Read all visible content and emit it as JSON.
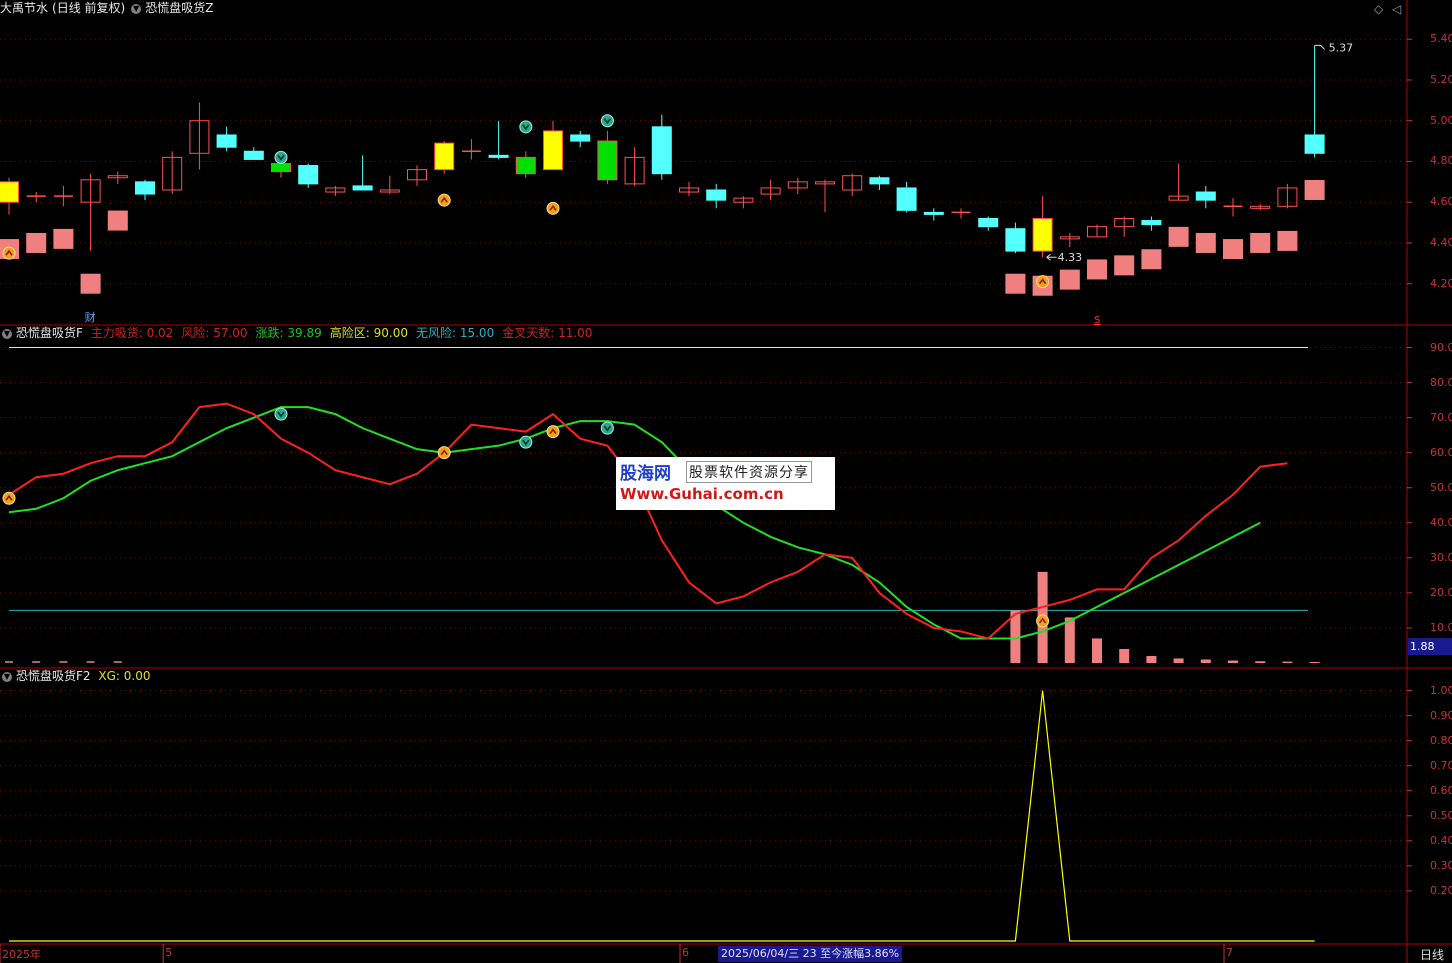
{
  "header": {
    "stock": "大禹节水",
    "period_mode": "(日线 前复权)",
    "indicator_main": "恐慌盘吸货Z"
  },
  "panel2": {
    "name": "恐慌盘吸货F",
    "items": [
      {
        "label": "主力吸货:",
        "value": "0.02",
        "color": "#d02020"
      },
      {
        "label": "风险:",
        "value": "57.00",
        "color": "#d02020"
      },
      {
        "label": "涨跌:",
        "value": "39.89",
        "color": "#20c020"
      },
      {
        "label": "高险区:",
        "value": "90.00",
        "color": "#e0e020"
      },
      {
        "label": "无风险:",
        "value": "15.00",
        "color": "#30b0c0"
      },
      {
        "label": "金叉天数:",
        "value": "11.00",
        "color": "#d02020"
      }
    ]
  },
  "panel3": {
    "name": "恐慌盘吸货F2",
    "items": [
      {
        "label": "XG:",
        "value": "0.00",
        "color": "#e0e020"
      }
    ]
  },
  "price_axis": [
    "5.40",
    "5.20",
    "5.00",
    "4.80",
    "4.60",
    "4.40",
    "4.20"
  ],
  "osc_axis": [
    "90.00",
    "80.00",
    "70.00",
    "60.00",
    "50.00",
    "40.00",
    "30.00",
    "20.00",
    "10.00"
  ],
  "xg_axis": [
    "1.00",
    "0.90",
    "0.80",
    "0.70",
    "0.60",
    "0.50",
    "0.40",
    "0.30",
    "0.20"
  ],
  "x_labels": [
    {
      "text": "2025年",
      "bar": 0
    },
    {
      "text": "5",
      "bar": 6
    },
    {
      "text": "6",
      "bar": 25
    },
    {
      "text": "7",
      "bar": 45
    }
  ],
  "cursor_readout": "2025/06/04/三 23 至今涨幅3.86%",
  "value_flag": "1.88",
  "period_label": "日线",
  "annotations": {
    "high": "5.37",
    "low": "4.33",
    "cai": "财",
    "s_mark": "S"
  },
  "watermark": {
    "line1": "股海网",
    "line2": "股票软件资源分享",
    "line3": "Www.Guhai.com.cn"
  },
  "colors": {
    "up": "#ff5050",
    "down": "#54ffff",
    "grid": "#8b0000",
    "red_line": "#ff2020",
    "green_line": "#20e020",
    "yellow": "#ffff00",
    "hl_up": "#ffff00",
    "hl_down": "#00e000"
  },
  "chart_data": {
    "type": "candlestick",
    "price_ylim": [
      4.12,
      5.46
    ],
    "osc_ylim": [
      0,
      95
    ],
    "xg_ylim": [
      0,
      1.05
    ],
    "candles": [
      {
        "o": 4.6,
        "h": 4.72,
        "l": 4.54,
        "c": 4.7,
        "hl": "yes"
      },
      {
        "o": 4.63,
        "h": 4.65,
        "l": 4.6,
        "c": 4.63
      },
      {
        "o": 4.63,
        "h": 4.68,
        "l": 4.58,
        "c": 4.63
      },
      {
        "o": 4.6,
        "h": 4.74,
        "l": 4.36,
        "c": 4.71
      },
      {
        "o": 4.72,
        "h": 4.75,
        "l": 4.69,
        "c": 4.73
      },
      {
        "o": 4.7,
        "h": 4.71,
        "l": 4.61,
        "c": 4.64
      },
      {
        "o": 4.66,
        "h": 4.85,
        "l": 4.64,
        "c": 4.82
      },
      {
        "o": 4.84,
        "h": 5.09,
        "l": 4.76,
        "c": 5.0
      },
      {
        "o": 4.93,
        "h": 4.97,
        "l": 4.85,
        "c": 4.87
      },
      {
        "o": 4.85,
        "h": 4.87,
        "l": 4.81,
        "c": 4.81
      },
      {
        "o": 4.75,
        "h": 4.79,
        "l": 4.72,
        "c": 4.79,
        "hl": "green"
      },
      {
        "o": 4.78,
        "h": 4.79,
        "l": 4.67,
        "c": 4.69
      },
      {
        "o": 4.65,
        "h": 4.68,
        "l": 4.63,
        "c": 4.67
      },
      {
        "o": 4.68,
        "h": 4.83,
        "l": 4.66,
        "c": 4.66
      },
      {
        "o": 4.65,
        "h": 4.73,
        "l": 4.64,
        "c": 4.66
      },
      {
        "o": 4.71,
        "h": 4.78,
        "l": 4.68,
        "c": 4.76
      },
      {
        "o": 4.76,
        "h": 4.9,
        "l": 4.74,
        "c": 4.89,
        "hl": "yes"
      },
      {
        "o": 4.85,
        "h": 4.91,
        "l": 4.81,
        "c": 4.85
      },
      {
        "o": 4.83,
        "h": 5.0,
        "l": 4.81,
        "c": 4.82
      },
      {
        "o": 4.82,
        "h": 4.85,
        "l": 4.72,
        "c": 4.74,
        "hl": "green"
      },
      {
        "o": 4.76,
        "h": 5.0,
        "l": 4.76,
        "c": 4.95,
        "hl": "yes"
      },
      {
        "o": 4.93,
        "h": 4.95,
        "l": 4.87,
        "c": 4.9
      },
      {
        "o": 4.9,
        "h": 4.95,
        "l": 4.69,
        "c": 4.71,
        "hl": "green"
      },
      {
        "o": 4.69,
        "h": 4.87,
        "l": 4.68,
        "c": 4.82
      },
      {
        "o": 4.97,
        "h": 5.03,
        "l": 4.71,
        "c": 4.74
      },
      {
        "o": 4.65,
        "h": 4.7,
        "l": 4.63,
        "c": 4.67
      },
      {
        "o": 4.66,
        "h": 4.69,
        "l": 4.57,
        "c": 4.61
      },
      {
        "o": 4.6,
        "h": 4.63,
        "l": 4.57,
        "c": 4.62
      },
      {
        "o": 4.64,
        "h": 4.71,
        "l": 4.61,
        "c": 4.67
      },
      {
        "o": 4.67,
        "h": 4.72,
        "l": 4.64,
        "c": 4.7
      },
      {
        "o": 4.69,
        "h": 4.71,
        "l": 4.55,
        "c": 4.7
      },
      {
        "o": 4.66,
        "h": 4.74,
        "l": 4.63,
        "c": 4.73
      },
      {
        "o": 4.72,
        "h": 4.73,
        "l": 4.66,
        "c": 4.69
      },
      {
        "o": 4.67,
        "h": 4.7,
        "l": 4.55,
        "c": 4.56
      },
      {
        "o": 4.55,
        "h": 4.57,
        "l": 4.51,
        "c": 4.54
      },
      {
        "o": 4.55,
        "h": 4.57,
        "l": 4.52,
        "c": 4.55
      },
      {
        "o": 4.52,
        "h": 4.53,
        "l": 4.46,
        "c": 4.48
      },
      {
        "o": 4.47,
        "h": 4.5,
        "l": 4.35,
        "c": 4.36
      },
      {
        "o": 4.36,
        "h": 4.63,
        "l": 4.33,
        "c": 4.52,
        "hl": "yes"
      },
      {
        "o": 4.42,
        "h": 4.45,
        "l": 4.38,
        "c": 4.43
      },
      {
        "o": 4.43,
        "h": 4.49,
        "l": 4.43,
        "c": 4.48
      },
      {
        "o": 4.48,
        "h": 4.53,
        "l": 4.43,
        "c": 4.52
      },
      {
        "o": 4.51,
        "h": 4.53,
        "l": 4.46,
        "c": 4.49
      },
      {
        "o": 4.61,
        "h": 4.79,
        "l": 4.61,
        "c": 4.63
      },
      {
        "o": 4.65,
        "h": 4.68,
        "l": 4.57,
        "c": 4.61
      },
      {
        "o": 4.58,
        "h": 4.62,
        "l": 4.53,
        "c": 4.58
      },
      {
        "o": 4.57,
        "h": 4.59,
        "l": 4.56,
        "c": 4.58
      },
      {
        "o": 4.58,
        "h": 4.69,
        "l": 4.57,
        "c": 4.67
      },
      {
        "o": 4.93,
        "h": 5.37,
        "l": 4.82,
        "c": 4.84
      }
    ],
    "pink_blocks": [
      {
        "bar": 0,
        "v": 4.37
      },
      {
        "bar": 1,
        "v": 4.4
      },
      {
        "bar": 2,
        "v": 4.42
      },
      {
        "bar": 3,
        "v": 4.2
      },
      {
        "bar": 4,
        "v": 4.51
      },
      {
        "bar": 37,
        "v": 4.2
      },
      {
        "bar": 38,
        "v": 4.19
      },
      {
        "bar": 39,
        "v": 4.22
      },
      {
        "bar": 40,
        "v": 4.27
      },
      {
        "bar": 41,
        "v": 4.29
      },
      {
        "bar": 42,
        "v": 4.32
      },
      {
        "bar": 43,
        "v": 4.43
      },
      {
        "bar": 44,
        "v": 4.4
      },
      {
        "bar": 45,
        "v": 4.37
      },
      {
        "bar": 46,
        "v": 4.4
      },
      {
        "bar": 47,
        "v": 4.41
      },
      {
        "bar": 48,
        "v": 4.66
      }
    ],
    "signals_up_price": [
      {
        "bar": 0,
        "v": 4.35
      },
      {
        "bar": 16,
        "v": 4.61
      },
      {
        "bar": 20,
        "v": 4.57
      },
      {
        "bar": 38,
        "v": 4.21
      }
    ],
    "signals_down_price": [
      {
        "bar": 10,
        "v": 4.82
      },
      {
        "bar": 19,
        "v": 4.97
      },
      {
        "bar": 22,
        "v": 5.0
      }
    ],
    "risk": [
      48,
      53,
      54,
      57,
      59,
      59,
      63,
      73,
      74,
      71,
      64,
      60,
      55,
      53,
      51,
      54,
      60,
      68,
      67,
      66,
      71,
      64,
      62,
      52,
      35,
      23,
      17,
      19,
      23,
      26,
      31,
      30,
      20,
      14,
      10,
      9,
      7,
      14,
      16,
      18,
      21,
      21,
      30,
      35,
      42,
      48,
      56,
      57
    ],
    "trend": [
      43,
      44,
      47,
      52,
      55,
      57,
      59,
      63,
      67,
      70,
      73,
      73,
      71,
      67,
      64,
      61,
      60,
      61,
      62,
      64,
      67,
      69,
      69,
      68,
      63,
      55,
      45,
      40,
      36,
      33,
      31,
      28,
      23,
      16,
      11,
      7,
      7,
      7,
      9,
      12,
      16,
      20,
      24,
      28,
      32,
      36,
      40
    ],
    "bars_osc": [
      {
        "bar": 37,
        "v": 15
      },
      {
        "bar": 38,
        "v": 26
      },
      {
        "bar": 39,
        "v": 13
      },
      {
        "bar": 40,
        "v": 7
      },
      {
        "bar": 41,
        "v": 4
      },
      {
        "bar": 42,
        "v": 2
      },
      {
        "bar": 43,
        "v": 1.3
      },
      {
        "bar": 44,
        "v": 1
      },
      {
        "bar": 45,
        "v": 0.7
      },
      {
        "bar": 46,
        "v": 0.5
      },
      {
        "bar": 47,
        "v": 0.4
      },
      {
        "bar": 48,
        "v": 0.3
      }
    ],
    "ticks_osc": [
      0,
      1,
      2,
      3,
      4
    ],
    "high_risk_level": 90,
    "no_risk_level": 15,
    "signals_up_osc": [
      {
        "bar": 0,
        "v": 47
      },
      {
        "bar": 16,
        "v": 60
      },
      {
        "bar": 20,
        "v": 66
      },
      {
        "bar": 38,
        "v": 12
      }
    ],
    "signals_down_osc": [
      {
        "bar": 10,
        "v": 71
      },
      {
        "bar": 19,
        "v": 63
      },
      {
        "bar": 22,
        "v": 67
      }
    ],
    "xg": [
      0,
      0,
      0,
      0,
      0,
      0,
      0,
      0,
      0,
      0,
      0,
      0,
      0,
      0,
      0,
      0,
      0,
      0,
      0,
      0,
      0,
      0,
      0,
      0,
      0,
      0,
      0,
      0,
      0,
      0,
      0,
      0,
      0,
      0,
      0,
      0,
      0,
      0,
      1,
      0,
      0,
      0,
      0,
      0,
      0,
      0,
      0,
      0,
      0
    ]
  }
}
